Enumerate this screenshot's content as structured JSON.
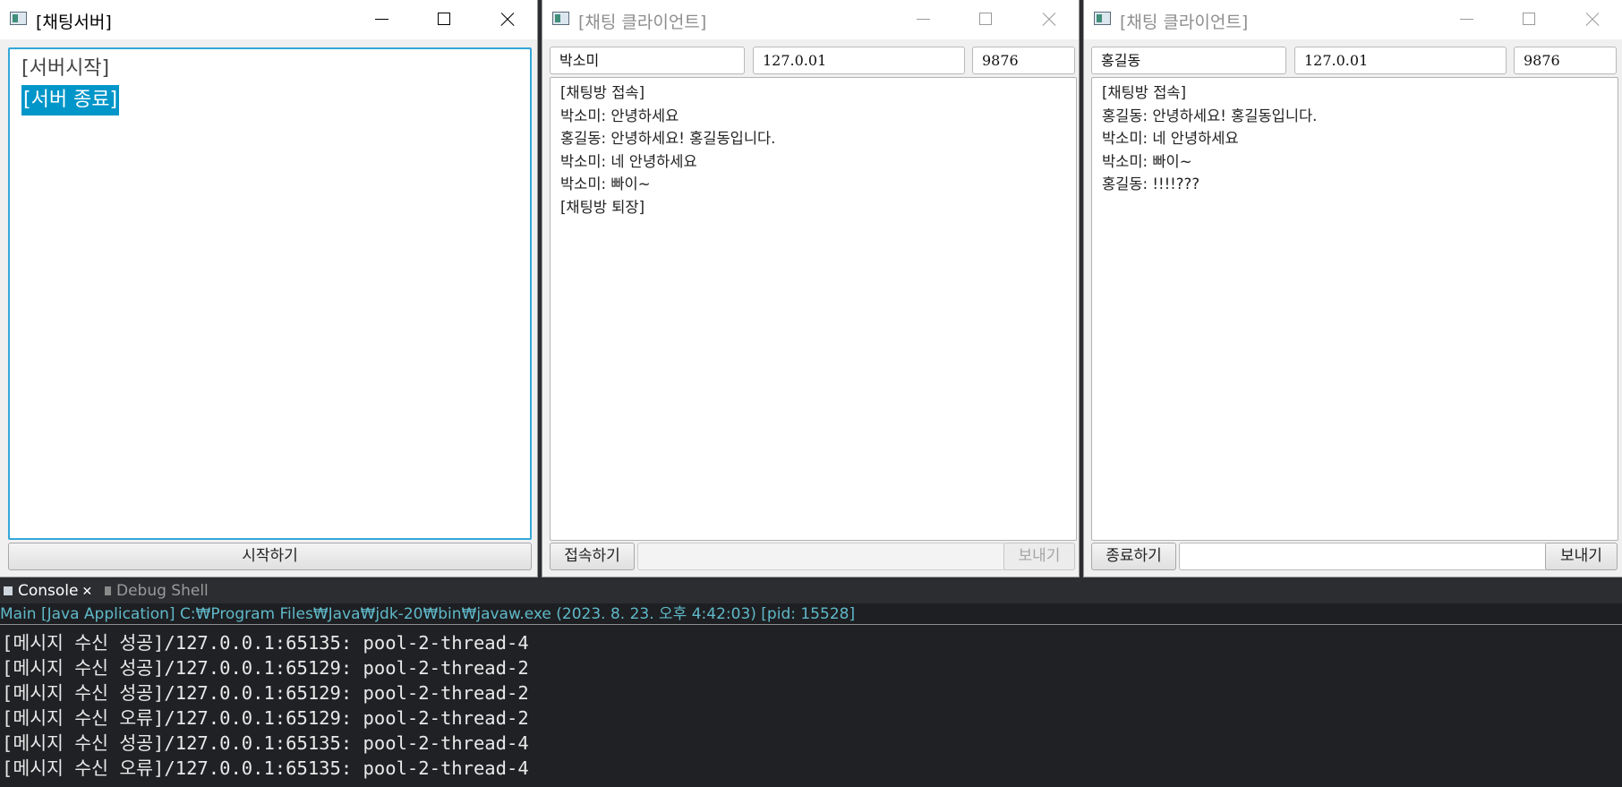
{
  "server_window": {
    "title": "[채팅서버]",
    "log_lines": [
      "[서버시작]"
    ],
    "selected_line": "[서버 종료]",
    "start_button": "시작하기"
  },
  "client_left": {
    "title": "[채팅 클라이언트]",
    "name": "박소미",
    "ip": "127.0.01",
    "port": "9876",
    "messages": [
      "[채팅방 접속]",
      "박소미: 안녕하세요",
      "홍길동: 안녕하세요! 홍길동입니다.",
      "박소미: 네 안녕하세요",
      "박소미: 빠이~",
      "[채팅방 퇴장]"
    ],
    "connect_button": "접속하기",
    "send_button": "보내기",
    "input_value": ""
  },
  "client_right": {
    "title": "[채팅 클라이언트]",
    "name": "홍길동",
    "ip": "127.0.01",
    "port": "9876",
    "messages": [
      "[채팅방 접속]",
      "홍길동: 안녕하세요! 홍길동입니다.",
      "박소미: 네 안녕하세요",
      "박소미: 빠이~",
      "홍길동: !!!!???"
    ],
    "connect_button": "종료하기",
    "send_button": "보내기",
    "input_value": ""
  },
  "console": {
    "tab_console": "Console",
    "tab_debug": "Debug Shell",
    "launch_info": "Main [Java Application] C:₩Program Files₩Java₩jdk-20₩bin₩javaw.exe  (2023. 8. 23. 오후 4:42:03) [pid: 15528]",
    "lines": [
      "[메시지 수신 성공]/127.0.0.1:65135: pool-2-thread-4",
      "[메시지 수신 성공]/127.0.0.1:65129: pool-2-thread-2",
      "[메시지 수신 성공]/127.0.0.1:65129: pool-2-thread-2",
      "[메시지 수신 오류]/127.0.0.1:65129: pool-2-thread-2",
      "[메시지 수신 성공]/127.0.0.1:65135: pool-2-thread-4",
      "[메시지 수신 오류]/127.0.0.1:65135: pool-2-thread-4"
    ]
  },
  "icons": {
    "app": "java-window-icon",
    "minimize": "minimize-icon",
    "maximize": "maximize-icon",
    "close": "close-icon",
    "console": "console-icon",
    "debug": "debug-shell-icon"
  },
  "colors": {
    "focus_border": "#35a7d9",
    "selection": "#0096c9",
    "console_bg": "#1f2124",
    "launch_text": "#5fb9c9"
  }
}
